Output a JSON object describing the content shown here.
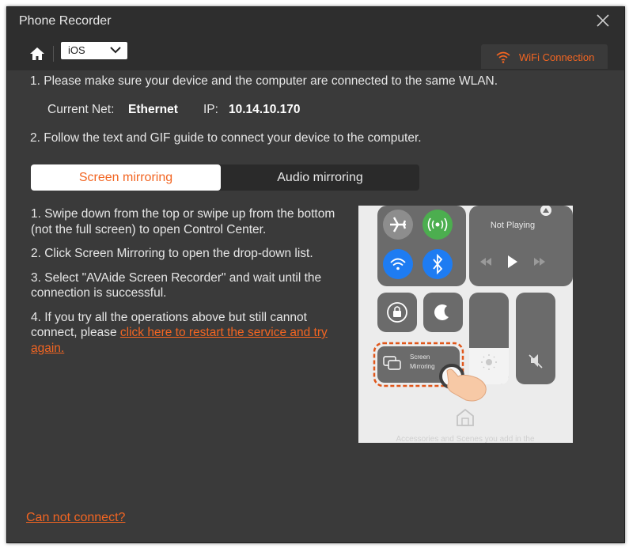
{
  "window": {
    "title": "Phone Recorder"
  },
  "toolbar": {
    "os_select_value": "iOS",
    "wifi_tab_label": "WiFi Connection"
  },
  "instructions": {
    "step1": "1. Please make sure your device and the computer are connected to the same WLAN.",
    "current_net_label": "Current Net:",
    "current_net_value": "Ethernet",
    "ip_label": "IP:",
    "ip_value": "10.14.10.170",
    "step2": "2. Follow the text and GIF guide to connect your device to the computer."
  },
  "tabs": {
    "screen_mirroring": "Screen mirroring",
    "audio_mirroring": "Audio mirroring"
  },
  "steps": {
    "s1": "1. Swipe down from the top or swipe up from the bottom (not the full screen) to open Control Center.",
    "s2": "2. Click Screen Mirroring to open the drop-down list.",
    "s3": "3. Select \"AVAide Screen Recorder\" and wait until the connection is successful.",
    "s4_prefix": "4. If you try all the operations above but still cannot connect, please ",
    "s4_link": "click here to restart the service and try again."
  },
  "gif": {
    "not_playing": "Not Playing",
    "screen_mirroring_line1": "Screen",
    "screen_mirroring_line2": "Mirroring",
    "accessories_text": "Accessories and Scenes you add in the"
  },
  "footer": {
    "cannot_connect": "Can not connect?"
  },
  "colors": {
    "accent": "#f26522",
    "window_bg": "#3a3a3a",
    "titlebar_bg": "#2e2e2e"
  }
}
